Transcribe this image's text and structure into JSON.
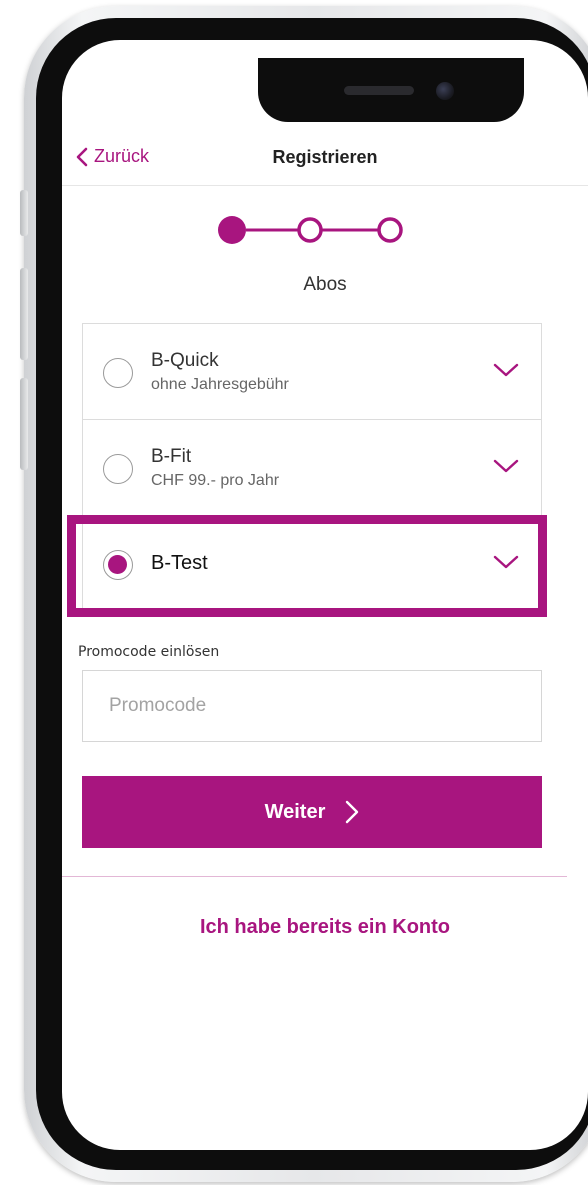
{
  "nav": {
    "back_label": "Zurück",
    "title": "Registrieren"
  },
  "stepper": {
    "total_steps": 3,
    "current_step": 1
  },
  "step_title": "Abos",
  "subscriptions": [
    {
      "name": "B-Quick",
      "subtitle": "ohne Jahresgebühr",
      "selected": false
    },
    {
      "name": "B-Fit",
      "subtitle": "CHF 99.- pro Jahr",
      "selected": false
    },
    {
      "name": "B-Test",
      "subtitle": "",
      "selected": true
    }
  ],
  "promo": {
    "label": "Promocode einlösen",
    "placeholder": "Promocode",
    "value": ""
  },
  "next_button": {
    "label": "Weiter"
  },
  "login_link": "Ich habe bereits ein Konto",
  "colors": {
    "accent": "#a8157f",
    "text": "#333333",
    "muted": "#666666",
    "border": "#dcdcdc",
    "bezel": "#0d0d0d"
  },
  "icons": {
    "back": "chevron-left-icon",
    "expand": "chevron-down-icon",
    "next": "chevron-right-icon"
  }
}
